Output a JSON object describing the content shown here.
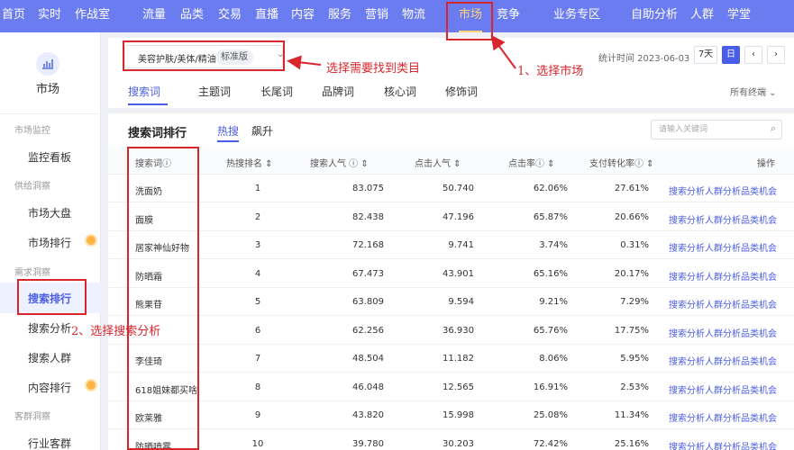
{
  "topnav": {
    "items": [
      "首页",
      "实时",
      "作战室",
      "流量",
      "品类",
      "交易",
      "直播",
      "内容",
      "服务",
      "营销",
      "物流",
      "市场",
      "竞争",
      "业务专区",
      "自助分析",
      "人群",
      "学堂"
    ],
    "active_index": 11
  },
  "sidebar": {
    "market_label": "市场",
    "market_icon": "chart-icon",
    "groups": [
      {
        "title": "市场监控",
        "items": [
          "监控看板"
        ]
      },
      {
        "title": "供给洞察",
        "items": [
          "市场大盘",
          "市场排行"
        ]
      },
      {
        "title": "需求洞察",
        "items": [
          "搜索排行",
          "搜索分析",
          "搜索人群",
          "内容排行"
        ]
      },
      {
        "title": "客群洞察",
        "items": [
          "行业客群"
        ]
      }
    ],
    "active_item": "搜索排行"
  },
  "header": {
    "category": "美容护肤/美体/精油",
    "edition": "标准版",
    "stat_time": "统计时间 2023-06-03",
    "range_7d": "7天",
    "range_day": "日",
    "prev": "‹",
    "next": "›",
    "tabs": [
      "搜索词",
      "主题词",
      "长尾词",
      "品牌词",
      "核心词",
      "修饰词"
    ],
    "active_tab": "搜索词",
    "all_terminals": "所有终端 ⌄"
  },
  "ranking": {
    "title": "搜索词排行",
    "tabs": [
      "热搜",
      "飙升"
    ],
    "active_tab": "热搜",
    "search_placeholder": "请输入关键词",
    "columns": [
      "搜索词ⓘ",
      "热搜排名 ⇕",
      "搜索人气 ⓘ ⇕",
      "点击人气 ⇕",
      "点击率ⓘ ⇕",
      "支付转化率ⓘ ⇕",
      "操作"
    ],
    "actions": [
      "搜索分析",
      "人群分析",
      "品类机会"
    ],
    "rows": [
      {
        "term": "洗面奶",
        "rank": "1",
        "search_pop": "83.075",
        "click_pop": "50.740",
        "ctr": "62.06%",
        "cvr": "27.61%"
      },
      {
        "term": "面膜",
        "rank": "2",
        "search_pop": "82.438",
        "click_pop": "47.196",
        "ctr": "65.87%",
        "cvr": "20.66%"
      },
      {
        "term": "居家神仙好物",
        "rank": "3",
        "search_pop": "72.168",
        "click_pop": "9.741",
        "ctr": "3.74%",
        "cvr": "0.31%"
      },
      {
        "term": "防晒霜",
        "rank": "4",
        "search_pop": "67.473",
        "click_pop": "43.901",
        "ctr": "65.16%",
        "cvr": "20.17%"
      },
      {
        "term": "熊果苷",
        "rank": "5",
        "search_pop": "63.809",
        "click_pop": "9.594",
        "ctr": "9.21%",
        "cvr": "7.29%"
      },
      {
        "term": "",
        "rank": "6",
        "search_pop": "62.256",
        "click_pop": "36.930",
        "ctr": "65.76%",
        "cvr": "17.75%"
      },
      {
        "term": "李佳琦",
        "rank": "7",
        "search_pop": "48.504",
        "click_pop": "11.182",
        "ctr": "8.06%",
        "cvr": "5.95%"
      },
      {
        "term": "618姐妹都买啥",
        "rank": "8",
        "search_pop": "46.048",
        "click_pop": "12.565",
        "ctr": "16.91%",
        "cvr": "2.53%"
      },
      {
        "term": "欧莱雅",
        "rank": "9",
        "search_pop": "43.820",
        "click_pop": "15.998",
        "ctr": "25.08%",
        "cvr": "11.34%"
      },
      {
        "term": "防晒喷雾",
        "rank": "10",
        "search_pop": "39.780",
        "click_pop": "30.203",
        "ctr": "72.42%",
        "cvr": "25.16%"
      }
    ]
  },
  "annotations": {
    "step1": "1、选择市场",
    "step2": "2、选择搜索分析",
    "step3": "选择需要找到类目",
    "color": "#d9262c"
  }
}
